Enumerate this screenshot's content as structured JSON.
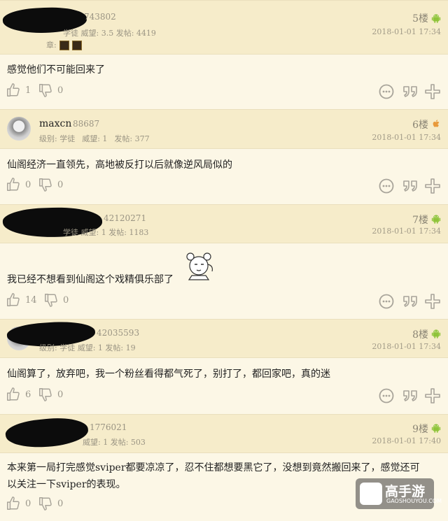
{
  "posts": [
    {
      "uid": "743802",
      "meta": "学徒 威望: 3.5 发帖: 4419",
      "badge_label": "章:",
      "floor": "5楼",
      "device": "android-icon",
      "time": "2018-01-01 17:34",
      "content": "感觉他们不可能回来了",
      "likes": "1",
      "dislikes": "0"
    },
    {
      "name": "maxcn",
      "uid": "88687",
      "level_label": "级别: 学徒",
      "rep_label": "威望: 1",
      "posts_label": "发帖: 377",
      "floor": "6楼",
      "device": "apple-icon",
      "time": "2018-01-01 17:34",
      "content": "仙阁经济一直领先，高地被反打以后就像逆风局似的",
      "likes": "0",
      "dislikes": "0"
    },
    {
      "uid": "42120271",
      "meta": "学徒 威望: 1 发帖: 1183",
      "floor": "7楼",
      "device": "android-icon",
      "time": "2018-01-01 17:34",
      "content": "我已经不想看到仙阁这个戏精俱乐部了",
      "likes": "14",
      "dislikes": "0"
    },
    {
      "uid": "42035593",
      "meta": "级别: 学徒 威望: 1 发帖: 19",
      "floor": "8楼",
      "device": "android-icon",
      "time": "2018-01-01 17:34",
      "content": "仙阁算了，放弃吧，我一个粉丝看得都气死了，别打了，都回家吧，真的迷",
      "likes": "6",
      "dislikes": "0"
    },
    {
      "uid": "1776021",
      "meta": "威望: 1 发帖: 503",
      "floor": "9楼",
      "device": "android-icon",
      "time": "2018-01-01 17:40",
      "content_line1": "本来第一局打完感觉sviper都要凉凉了，忍不住都想要黑它了，没想到竟然搬回来了，感觉还可",
      "content_line2": "以关注一下sviper的表现。",
      "likes": "0",
      "dislikes": "0"
    }
  ],
  "watermark": {
    "title": "高手游",
    "url": "GAOSHOUYOU.COM"
  },
  "colors": {
    "background": "#fcf7e6",
    "header": "#f6ecca",
    "android": "#8fc43a",
    "apple": "#e89a3c",
    "icon": "#a8a49a"
  }
}
